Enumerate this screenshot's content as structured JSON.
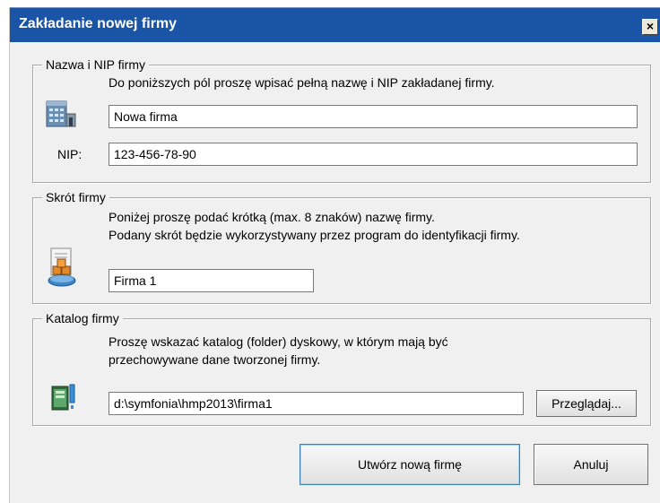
{
  "window": {
    "title": "Zakładanie nowej firmy",
    "close_label": "×"
  },
  "groups": {
    "name_nip": {
      "legend": "Nazwa i NIP firmy",
      "description": "Do poniższych pól proszę wpisać pełną nazwę i NIP zakładanej firmy.",
      "name_value": "Nowa firma",
      "nip_label": "NIP:",
      "nip_value": "123-456-78-90",
      "icon": "building-icon"
    },
    "short_name": {
      "legend": "Skrót firmy",
      "description_line1": "Poniżej proszę podać krótką (max. 8 znaków) nazwę firmy.",
      "description_line2": "Podany skrót będzie wykorzystywany przez program do identyfikacji firmy.",
      "value": "Firma 1",
      "icon": "company-boxes-icon"
    },
    "catalog": {
      "legend": "Katalog firmy",
      "description_line1": "Proszę wskazać katalog (folder) dyskowy, w którym mają być",
      "description_line2": "przechowywane dane tworzonej firmy.",
      "path_value": "d:\\symfonia\\hmp2013\\firma1",
      "browse_label": "Przeglądaj...",
      "icon": "folder-data-icon"
    }
  },
  "footer": {
    "create_label": "Utwórz nową firmę",
    "cancel_label": "Anuluj"
  },
  "colors": {
    "titlebar": "#1a54a6",
    "dialog_background": "#f0f0f0"
  }
}
